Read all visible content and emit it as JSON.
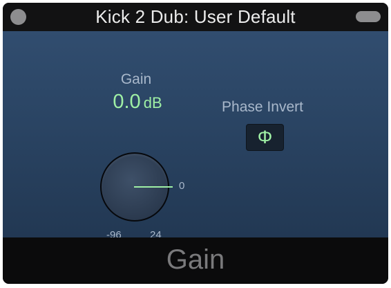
{
  "window": {
    "title": "Kick 2 Dub: User Default"
  },
  "gain": {
    "label": "Gain",
    "value": "0.0",
    "unit": "dB",
    "knob_value_db": 0.0,
    "range_min": "-96",
    "range_max": "24",
    "tick_zero": "0"
  },
  "phase_invert": {
    "label": "Phase Invert",
    "symbol": "Φ"
  },
  "footer": {
    "label": "Gain"
  },
  "colors": {
    "accent": "#9ff0a5",
    "panel_top": "#314d6f",
    "panel_bottom": "#223853",
    "label_text": "#a9b8cb"
  }
}
